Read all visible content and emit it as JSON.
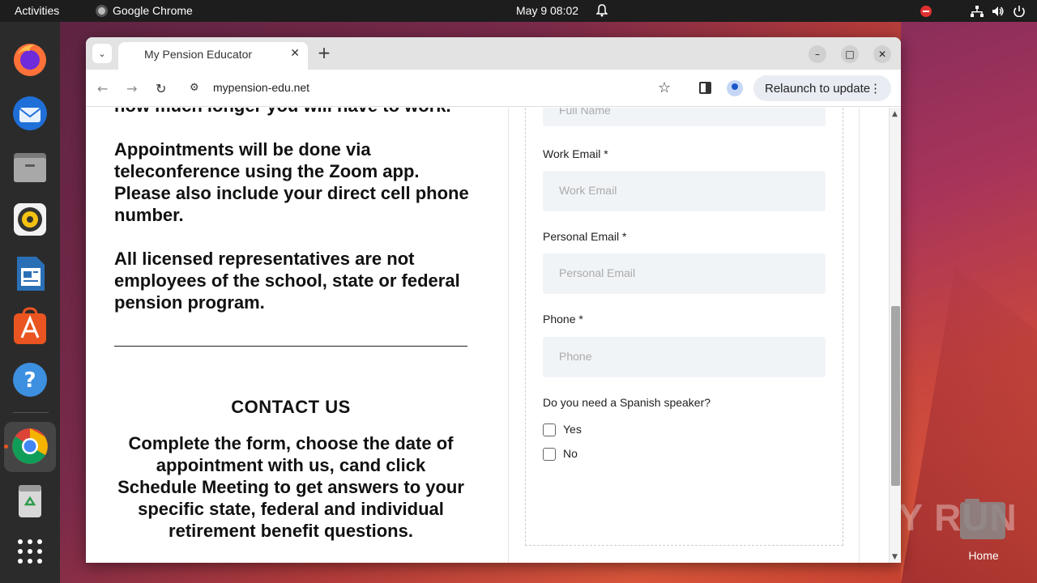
{
  "topbar": {
    "activities": "Activities",
    "app_name": "Google Chrome",
    "clock": "May 9  08:02"
  },
  "dock": {
    "items": [
      "firefox-icon",
      "thunderbird-icon",
      "files-icon",
      "rhythmbox-icon",
      "writer-icon",
      "app-center-icon",
      "help-icon",
      "chrome-icon",
      "trash-icon",
      "show-apps-icon"
    ]
  },
  "browser": {
    "tab_title": "My Pension Educator",
    "url": "mypension-edu.net",
    "relaunch_label": "Relaunch to update"
  },
  "page": {
    "cut_line": "how much longer you will have to work.",
    "para1": "Appointments will be done via teleconference using the Zoom app. Please also include your direct cell phone number.",
    "para2": "All licensed representatives are not employees of the school, state or federal pension program.",
    "contact_title": "CONTACT US",
    "contact_text": "Complete the form, choose the date of appointment with us, cand click Schedule Meeting to get answers to your specific state, federal and individual retirement benefit questions."
  },
  "form": {
    "full_name_placeholder": "Full Name",
    "work_email_label": "Work Email *",
    "work_email_placeholder": "Work Email",
    "personal_email_label": "Personal Email *",
    "personal_email_placeholder": "Personal Email",
    "phone_label": "Phone *",
    "phone_placeholder": "Phone",
    "spanish_question": "Do you need a Spanish speaker?",
    "option_yes": "Yes",
    "option_no": "No"
  },
  "desktop": {
    "home_label": "Home",
    "watermark": "ANY RUN"
  }
}
